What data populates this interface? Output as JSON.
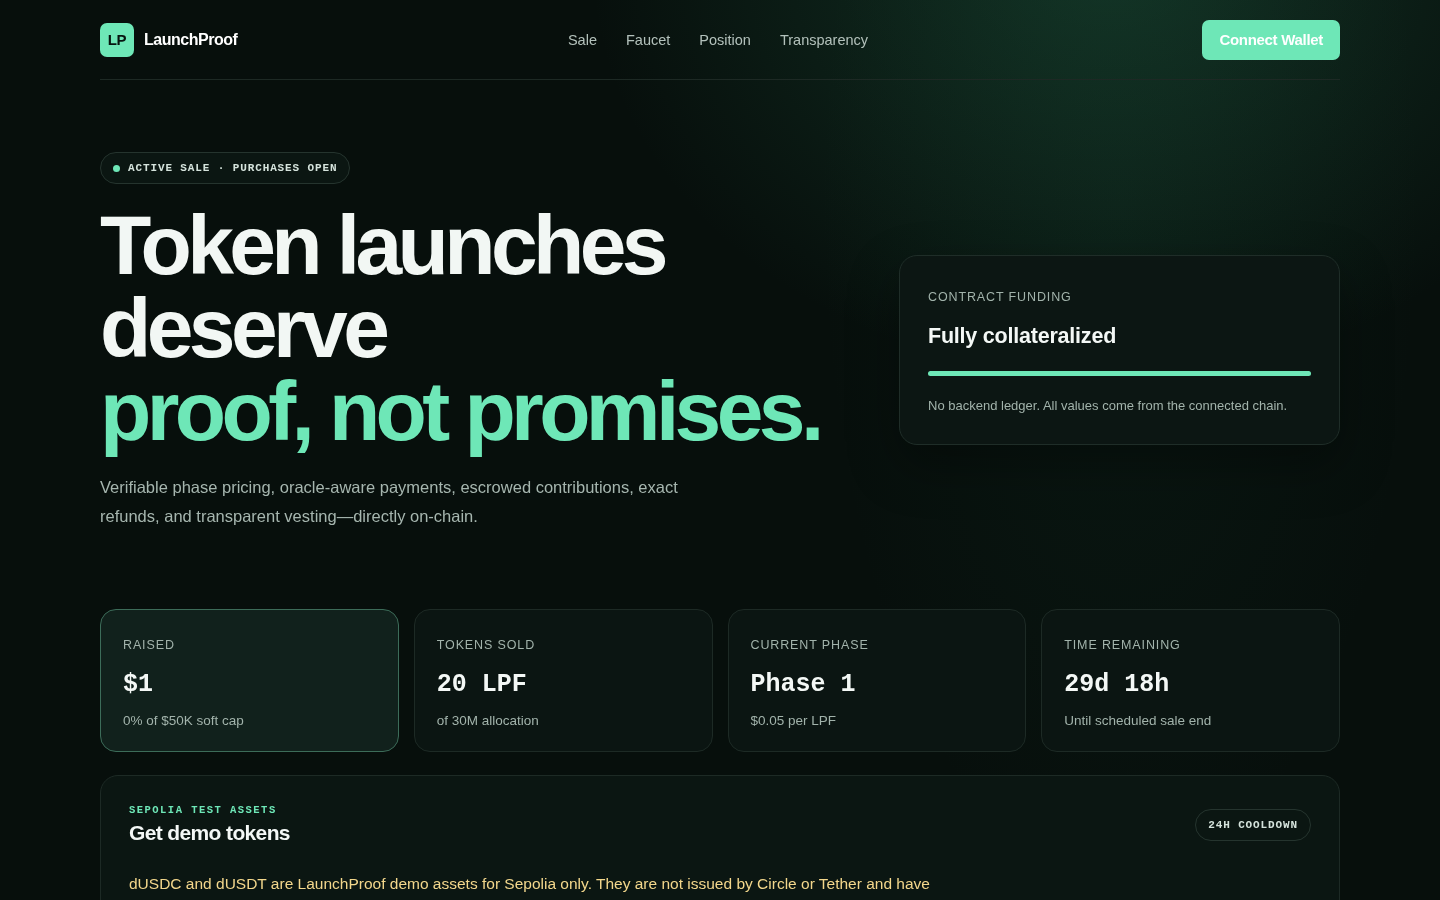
{
  "nav": {
    "logo_mark": "LP",
    "brand": "LaunchProof",
    "links": [
      {
        "label": "Sale"
      },
      {
        "label": "Faucet"
      },
      {
        "label": "Position"
      },
      {
        "label": "Transparency"
      }
    ],
    "connect_button": "Connect Wallet"
  },
  "hero": {
    "status_badge": {
      "text": "ACTIVE SALE · PURCHASES OPEN",
      "live": true
    },
    "headline": [
      {
        "text": "Token launches",
        "accent": false
      },
      {
        "text": "deserve",
        "accent": false
      },
      {
        "text": "proof, not promises.",
        "accent": true
      }
    ],
    "subtitle": "Verifiable phase pricing, oracle-aware payments, escrowed contributions, exact refunds, and transparent vesting—directly on-chain."
  },
  "funding_card": {
    "label": "CONTRACT FUNDING",
    "status": "Fully collateralized",
    "level": 1.0,
    "note": "No backend ledger. All values come from the connected chain."
  },
  "stats": [
    {
      "label": "RAISED",
      "value": "$1",
      "detail": "0% of $50K soft cap",
      "highlighted": true
    },
    {
      "label": "TOKENS SOLD",
      "value": "20 LPF",
      "detail": "of 30M allocation",
      "highlighted": false
    },
    {
      "label": "CURRENT PHASE",
      "value": "Phase 1",
      "detail": "$0.05 per LPF",
      "highlighted": false
    },
    {
      "label": "TIME REMAINING",
      "value": "29d 18h",
      "detail": "Until scheduled sale end",
      "highlighted": false
    }
  ],
  "faucet": {
    "eyebrow": "SEPOLIA TEST ASSETS",
    "title": "Get demo tokens",
    "cooldown_badge": "24H COOLDOWN",
    "notice": "dUSDC and dUSDT are LaunchProof demo assets for Sepolia only. They are not issued by Circle or Tether and have"
  }
}
